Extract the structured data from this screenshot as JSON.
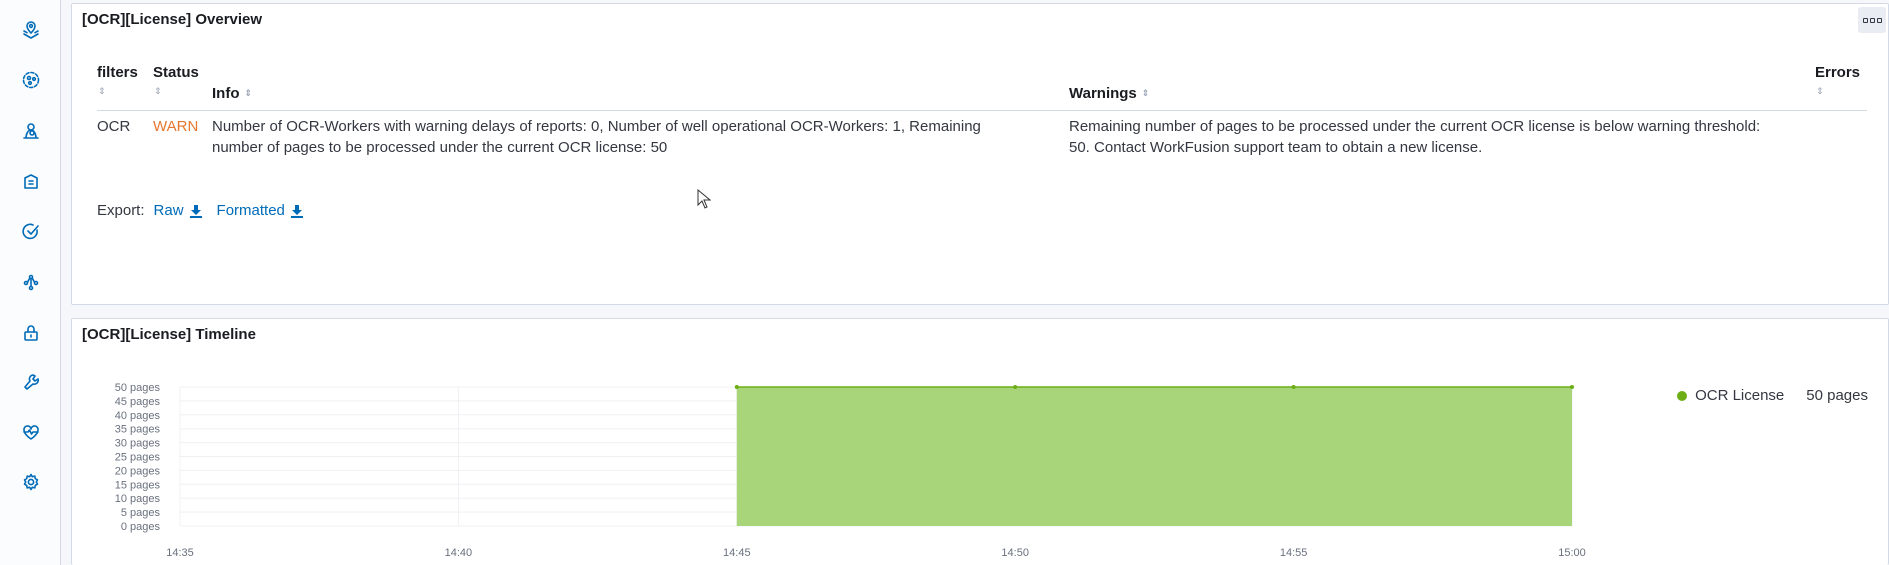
{
  "nav": {
    "icons": [
      "maps-icon",
      "network-icon",
      "user-search-icon",
      "documents-icon",
      "check-circle-icon",
      "graph-icon",
      "lock-icon",
      "wrench-icon",
      "heartbeat-icon",
      "gear-icon"
    ]
  },
  "overview": {
    "title": "[OCR][License] Overview",
    "columns": [
      "filters",
      "Status",
      "Info",
      "Warnings",
      "Errors"
    ],
    "rows": [
      {
        "filters": "OCR",
        "status": "WARN",
        "info_line1": "Number of OCR-Workers with warning delays of reports: 0, Number of well operational OCR-Workers: 1, Remaining",
        "info_line2": "number of pages to be processed under the current OCR license: 50",
        "warnings_line1": "Remaining number of pages to be processed under the current OCR license is below warning threshold:",
        "warnings_line2": "50. Contact WorkFusion support team to obtain a new license.",
        "errors": ""
      }
    ],
    "export_label": "Export:",
    "export_raw": "Raw",
    "export_formatted": "Formatted"
  },
  "timeline": {
    "title": "[OCR][License] Timeline",
    "legend_label": "OCR License",
    "legend_value": "50 pages"
  },
  "colors": {
    "accent": "#006bb8",
    "warn": "#e7772c",
    "series": "#6dae16",
    "series_fill": "#a9d57a"
  },
  "chart_data": {
    "type": "area",
    "x": [
      "14:45",
      "14:50",
      "14:55",
      "15:00"
    ],
    "series": [
      {
        "name": "OCR License",
        "values": [
          50,
          50,
          50,
          50
        ]
      }
    ],
    "x_ticks": [
      "14:35",
      "14:40",
      "14:45",
      "14:50",
      "14:55",
      "15:00"
    ],
    "y_ticks": [
      "0 pages",
      "5 pages",
      "10 pages",
      "15 pages",
      "20 pages",
      "25 pages",
      "30 pages",
      "35 pages",
      "40 pages",
      "45 pages",
      "50 pages"
    ],
    "ylim": [
      0,
      50
    ],
    "grid": true,
    "legend_position": "right"
  }
}
